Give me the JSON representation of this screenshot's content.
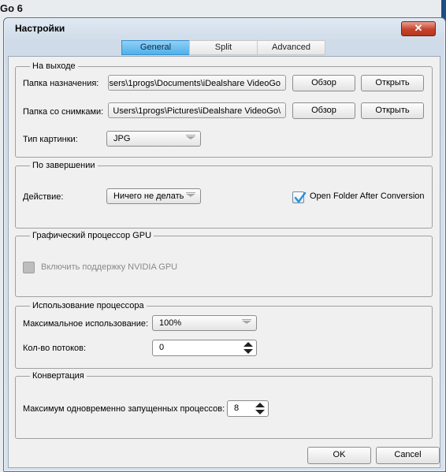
{
  "background": {
    "app_title": "Go 6"
  },
  "dialog": {
    "title": "Настройки",
    "close_glyph": "✕"
  },
  "tabs": [
    {
      "label": "General",
      "active": true
    },
    {
      "label": "Split",
      "active": false
    },
    {
      "label": "Advanced",
      "active": false
    }
  ],
  "output_group": {
    "title": "На выходе",
    "dest_label": "Папка назначения:",
    "dest_path": "sers\\1progs\\Documents\\iDealshare VideoGo",
    "snap_label": "Папка со снимками:",
    "snap_path": "\\Users\\1progs\\Pictures\\iDealshare VideoGo",
    "browse_label": "Обзор",
    "open_label": "Открыть",
    "image_type_label": "Тип картинки:",
    "image_type_value": "JPG"
  },
  "completion_group": {
    "title": "По завершении",
    "action_label": "Действие:",
    "action_value": "Ничего не делать",
    "open_folder_label": "Open Folder After Conversion",
    "open_folder_checked": true
  },
  "gpu_group": {
    "title": "Графический процессор GPU",
    "enable_label": "Включить поддержку NVIDIA GPU",
    "enabled": false
  },
  "cpu_group": {
    "title": "Использование процессора",
    "max_usage_label": "Максимальное использование:",
    "max_usage_value": "100%",
    "threads_label": "Кол-во потоков:",
    "threads_value": "0"
  },
  "conversion_group": {
    "title": "Конвертация",
    "max_processes_label": "Максимум одновременно запущенных процессов:",
    "max_processes_value": "8"
  },
  "footer": {
    "ok_label": "OK",
    "cancel_label": "Cancel"
  },
  "colors": {
    "active_tab": "#4fb0ea",
    "close_button": "#c5432b",
    "checkmark": "#2a8fd6"
  }
}
